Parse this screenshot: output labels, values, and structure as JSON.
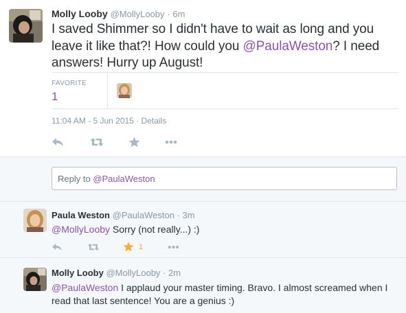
{
  "main_tweet": {
    "name": "Molly Looby",
    "handle": "@MollyLooby",
    "time": "· 6m",
    "text_before": "I saved Shimmer so I didn't have to wait as long and you leave it like that?! How could you ",
    "mention": "@PaulaWeston",
    "text_after": "? I need answers! Hurry up August!",
    "favorite_label": "FAVORITE",
    "favorite_count": "1",
    "timestamp": "11:04 AM - 5 Jun 2015",
    "details_sep": "·",
    "details_label": "Details",
    "icons": [
      "reply-icon",
      "retweet-icon",
      "favorite-star-icon",
      "more-icon"
    ]
  },
  "reply_box": {
    "placeholder": "Reply to ",
    "mention": "@PaulaWeston"
  },
  "replies": [
    {
      "name": "Paula Weston",
      "handle": "@PaulaWeston",
      "time": "· 3m",
      "mention": "@MollyLooby",
      "text": " Sorry (not really...) :)",
      "favorite_count": "1",
      "favorited": true
    },
    {
      "name": "Molly Looby",
      "handle": "@MollyLooby",
      "time": "· 2m",
      "mention": "@PaulaWeston",
      "text": " I applaud your master timing. Bravo. I almost screamed when I read that last sentence! You are a genius :)"
    }
  ],
  "colors": {
    "link": "#8a53a8",
    "muted": "#8899a6",
    "action_icon": "#aab8c2",
    "favorited_star": "#ffac33",
    "favorited_count": "#ff9f1c"
  }
}
